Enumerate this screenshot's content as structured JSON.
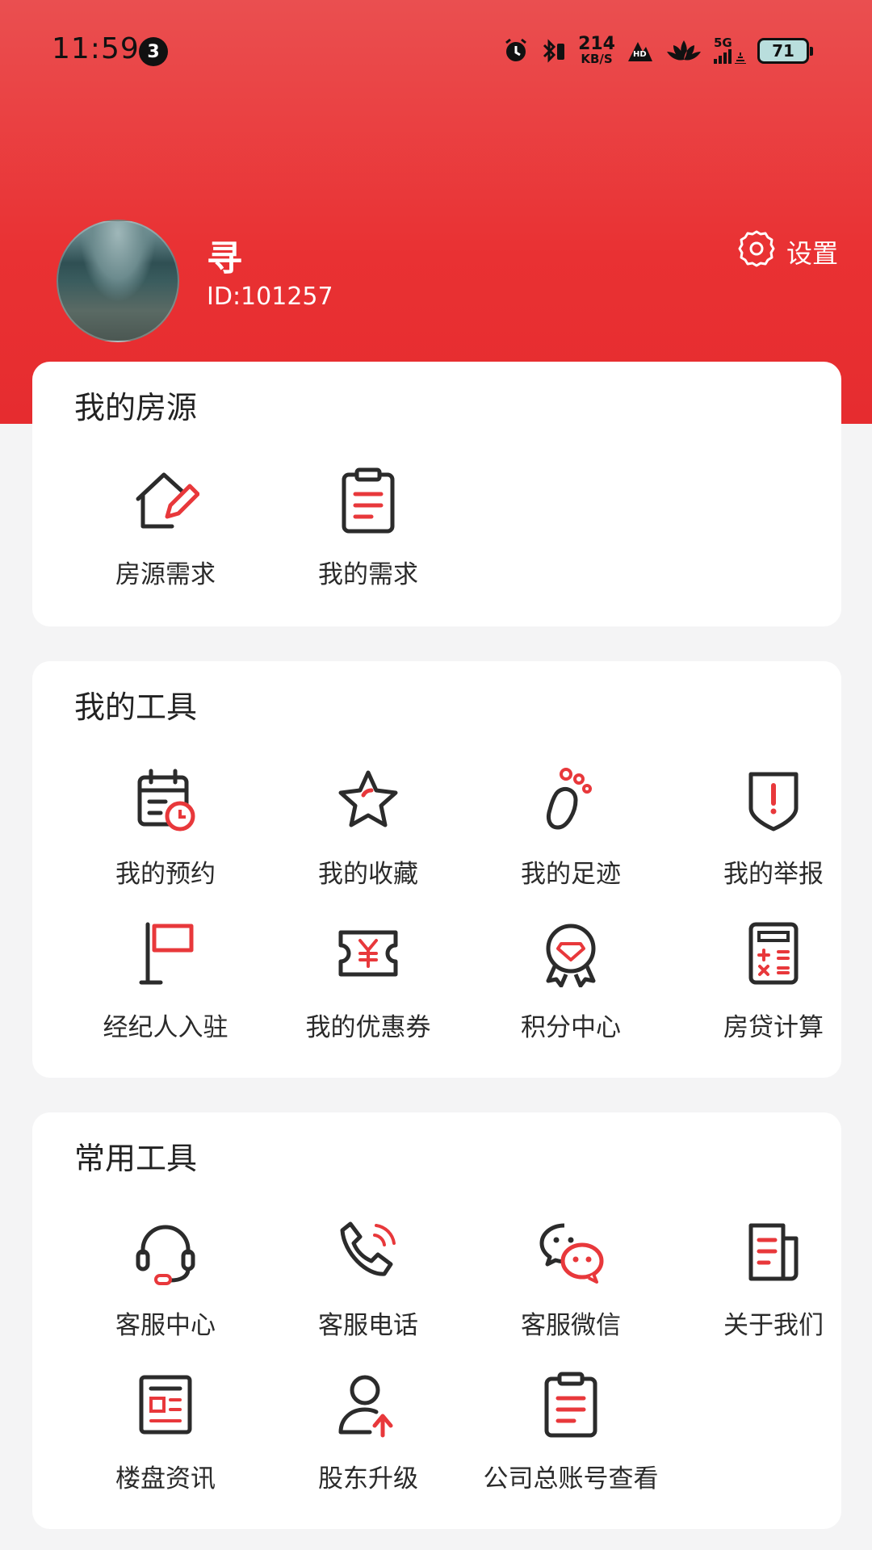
{
  "status_bar": {
    "time": "11:59",
    "notification_count": "3",
    "net_speed_value": "214",
    "net_speed_unit": "KB/S",
    "hd_label": "HD",
    "network_label": "5G",
    "battery": "71"
  },
  "profile": {
    "name": "寻",
    "id_text": "ID:101257",
    "settings_label": "设置"
  },
  "my_listings": {
    "title": "我的房源",
    "items": [
      {
        "label": "房源需求",
        "icon": "house-edit-icon"
      },
      {
        "label": "我的需求",
        "icon": "clipboard-icon"
      }
    ]
  },
  "my_tools": {
    "title": "我的工具",
    "items": [
      {
        "label": "我的预约",
        "icon": "calendar-clock-icon"
      },
      {
        "label": "我的收藏",
        "icon": "star-icon"
      },
      {
        "label": "我的足迹",
        "icon": "footprint-icon"
      },
      {
        "label": "我的举报",
        "icon": "shield-alert-icon"
      },
      {
        "label": "经纪人入驻",
        "icon": "flag-icon"
      },
      {
        "label": "我的优惠券",
        "icon": "coupon-icon"
      },
      {
        "label": "积分中心",
        "icon": "medal-icon"
      },
      {
        "label": "房贷计算",
        "icon": "calculator-icon"
      }
    ]
  },
  "common_tools": {
    "title": "常用工具",
    "items": [
      {
        "label": "客服中心",
        "icon": "headset-icon"
      },
      {
        "label": "客服电话",
        "icon": "phone-icon"
      },
      {
        "label": "客服微信",
        "icon": "wechat-icon"
      },
      {
        "label": "关于我们",
        "icon": "document-icon"
      },
      {
        "label": "楼盘资讯",
        "icon": "news-icon"
      },
      {
        "label": "股东升级",
        "icon": "user-upgrade-icon"
      },
      {
        "label": "公司总账号查看",
        "icon": "clipboard-list-icon"
      }
    ]
  },
  "colors": {
    "brand_red": "#e93133",
    "icon_dark": "#2b2b2b",
    "icon_accent": "#e8383b",
    "page_bg": "#f4f4f5"
  }
}
